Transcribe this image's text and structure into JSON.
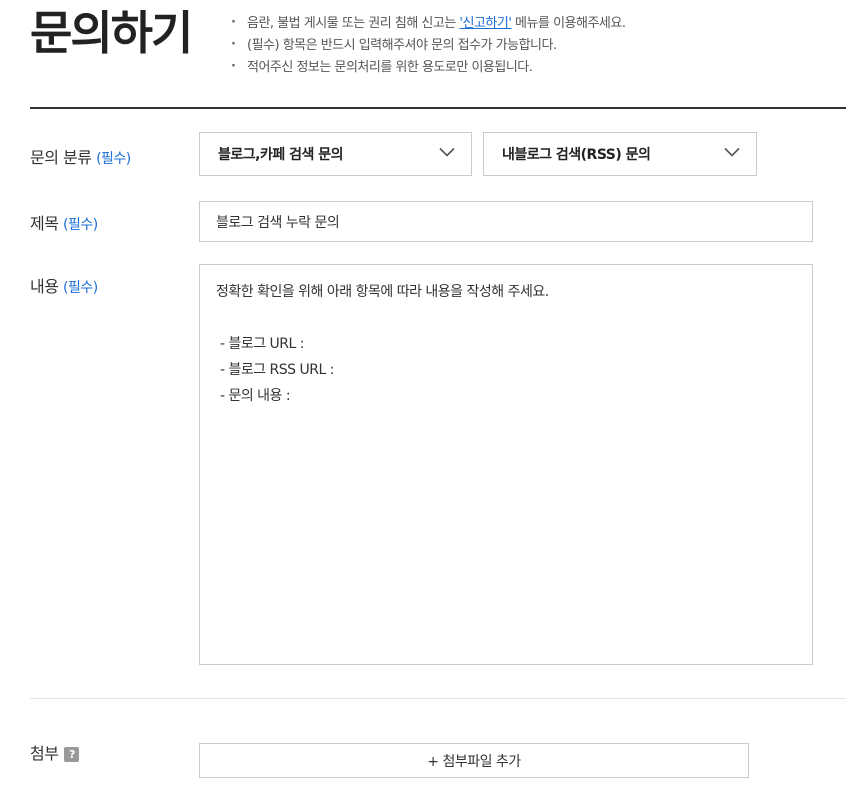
{
  "header": {
    "title": "문의하기",
    "notices": [
      {
        "before": "음란, 불법 게시물 또는 권리 침해 신고는 ",
        "link": "'신고하기'",
        "after": " 메뉴를 이용해주세요."
      },
      {
        "text": "(필수) 항목은 반드시 입력해주셔야 문의 접수가 가능합니다."
      },
      {
        "text": "적어주신 정보는 문의처리를 위한 용도로만 이용됩니다."
      }
    ]
  },
  "form": {
    "category": {
      "label": "문의 분류",
      "required": "(필수)",
      "primary_value": "블로그,카페 검색 문의",
      "secondary_value": "내블로그 검색(RSS) 문의"
    },
    "subject": {
      "label": "제목",
      "required": "(필수)",
      "value": "블로그 검색 누락 문의"
    },
    "content": {
      "label": "내용",
      "required": "(필수)",
      "value": "정확한 확인을 위해 아래 항목에 따라 내용을 작성해 주세요.\n\n - 블로그 URL :\n - 블로그 RSS URL :\n - 문의 내용 :"
    },
    "attachment": {
      "label": "첨부",
      "help_icon": "?",
      "button_label": "+ 첨부파일 추가"
    }
  },
  "colors": {
    "accent": "#1b6ed6",
    "title_rule": "#333333",
    "border": "#cccccc"
  }
}
